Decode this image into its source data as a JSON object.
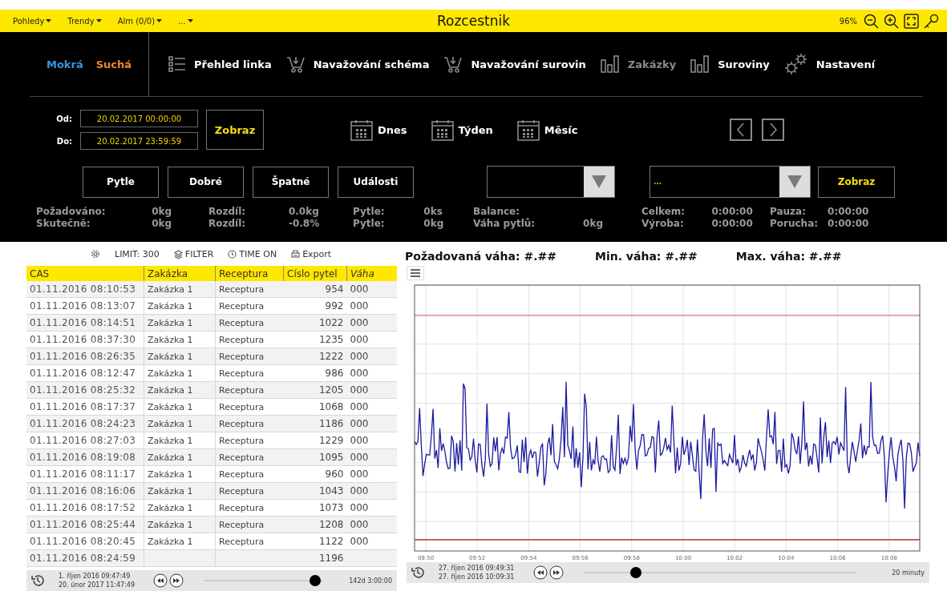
{
  "menubar": {
    "menus": [
      {
        "label": "Pohledy"
      },
      {
        "label": "Trendy"
      },
      {
        "label": "Alm (0/0)"
      },
      {
        "label": "..."
      }
    ],
    "title": "Rozcestnik",
    "zoom": "96%"
  },
  "modes": [
    {
      "label": "Mokrá",
      "color": "#3d94dc"
    },
    {
      "label": "Suchá",
      "color": "#ee8a2c"
    }
  ],
  "nav": [
    {
      "label": "Přehled linka",
      "kind": "list",
      "disabled": false
    },
    {
      "label": "Navažování schéma",
      "kind": "cart",
      "disabled": false
    },
    {
      "label": "Navažování surovin",
      "kind": "cart",
      "disabled": false
    },
    {
      "label": "Zakázky",
      "kind": "bars",
      "disabled": true
    },
    {
      "label": "Suroviny",
      "kind": "bars",
      "disabled": false
    },
    {
      "label": "Nastavení",
      "kind": "gears",
      "disabled": false
    }
  ],
  "range": {
    "from_label": "Od:",
    "from": "20.02.2017 00:00:00",
    "to_label": "Do:",
    "to": "20.02.2017 23:59:59",
    "button": "Zobraz"
  },
  "quick": [
    {
      "label": "Dnes"
    },
    {
      "label": "Týden"
    },
    {
      "label": "Měsíc"
    }
  ],
  "filters": [
    "Pytle",
    "Dobré",
    "Špatné",
    "Události"
  ],
  "selects": [
    {
      "kind": "blank"
    },
    {
      "kind": "filled",
      "value": "..."
    }
  ],
  "select_button": "Zobraz",
  "stats": [
    [
      {
        "label": "Požadováno:",
        "value": "0kg"
      },
      {
        "label": "Skutečně:",
        "value": "0kg"
      }
    ],
    [
      {
        "label": "Rozdíl:",
        "value": "0.0kg"
      },
      {
        "label": "Rozdíl:",
        "value": "-0.8%"
      }
    ],
    [
      {
        "label": "Pytle:",
        "value": "0ks"
      },
      {
        "label": "Pytle:",
        "value": "0kg"
      }
    ],
    [
      {
        "label": "Balance:"
      },
      {
        "label": "Váha pytlů:",
        "value": "0kg"
      }
    ],
    [
      {
        "label": "Celkem:",
        "value": "0:00:00"
      },
      {
        "label": "Výroba:",
        "value": "0:00:00"
      }
    ],
    [
      {
        "label": "Pauza:",
        "value": "0:00:00"
      },
      {
        "label": "Porucha:",
        "value": "0:00:00"
      }
    ]
  ],
  "toolbar": {
    "limit": "LIMIT: 300",
    "filter": "FILTER",
    "time": "TIME ON",
    "export": "Export"
  },
  "table": {
    "columns": [
      "CAS",
      "Zakázka",
      "Receptura",
      "Císlo pytel",
      "Váha"
    ],
    "rows": [
      [
        "01.11.2016 08:10:53",
        "Zakázka 1",
        "Receptura",
        "954",
        "000"
      ],
      [
        "01.11.2016 08:13:07",
        "Zakázka 1",
        "Receptura",
        "992",
        "000"
      ],
      [
        "01.11.2016 08:14:51",
        "Zakázka 1",
        "Receptura",
        "1022",
        "000"
      ],
      [
        "01.11.2016 08:37:30",
        "Zakázka 1",
        "Receptura",
        "1235",
        "000"
      ],
      [
        "01.11.2016 08:26:35",
        "Zakázka 1",
        "Receptura",
        "1222",
        "000"
      ],
      [
        "01.11.2016 08:12:47",
        "Zakázka 1",
        "Receptura",
        "986",
        "000"
      ],
      [
        "01.11.2016 08:25:32",
        "Zakázka 1",
        "Receptura",
        "1205",
        "000"
      ],
      [
        "01.11.2016 08:17:37",
        "Zakázka 1",
        "Receptura",
        "1068",
        "000"
      ],
      [
        "01.11.2016 08:24:23",
        "Zakázka 1",
        "Receptura",
        "1186",
        "000"
      ],
      [
        "01.11.2016 08:27:03",
        "Zakázka 1",
        "Receptura",
        "1229",
        "000"
      ],
      [
        "01.11.2016 08:19:08",
        "Zakázka 1",
        "Receptura",
        "1095",
        "000"
      ],
      [
        "01.11.2016 08:11:17",
        "Zakázka 1",
        "Receptura",
        "960",
        "000"
      ],
      [
        "01.11.2016 08:16:06",
        "Zakázka 1",
        "Receptura",
        "1043",
        "000"
      ],
      [
        "01.11.2016 08:17:52",
        "Zakázka 1",
        "Receptura",
        "1073",
        "000"
      ],
      [
        "01.11.2016 08:25:44",
        "Zakázka 1",
        "Receptura",
        "1208",
        "000"
      ],
      [
        "01.11.2016 08:20:45",
        "Zakázka 1",
        "Receptura",
        "1122",
        "000"
      ],
      [
        "01.11.2016 08:24:59",
        null,
        null,
        "1196",
        null
      ]
    ]
  },
  "table_timebar": {
    "start": "1. říjen 2016 09:47:49",
    "end": "20. únor 2017 11:47:49",
    "level": 0.93,
    "duration": "142d 3:00:00"
  },
  "chart": {
    "headers": [
      "Požadovaná váha: #.##",
      "Min. váha: #.##",
      "Max. váha: #.##"
    ],
    "x_labels": [
      "09:50",
      "09:52",
      "09:54",
      "09:56",
      "09:58",
      "10:00",
      "10:02",
      "10:04",
      "10:06",
      "10:08"
    ]
  },
  "chart_timebar": {
    "start": "27. říjen 2016 09:49:31",
    "end": "27. říjen 2016 10:09:31",
    "level": 0.19,
    "duration": "20 minuty"
  }
}
